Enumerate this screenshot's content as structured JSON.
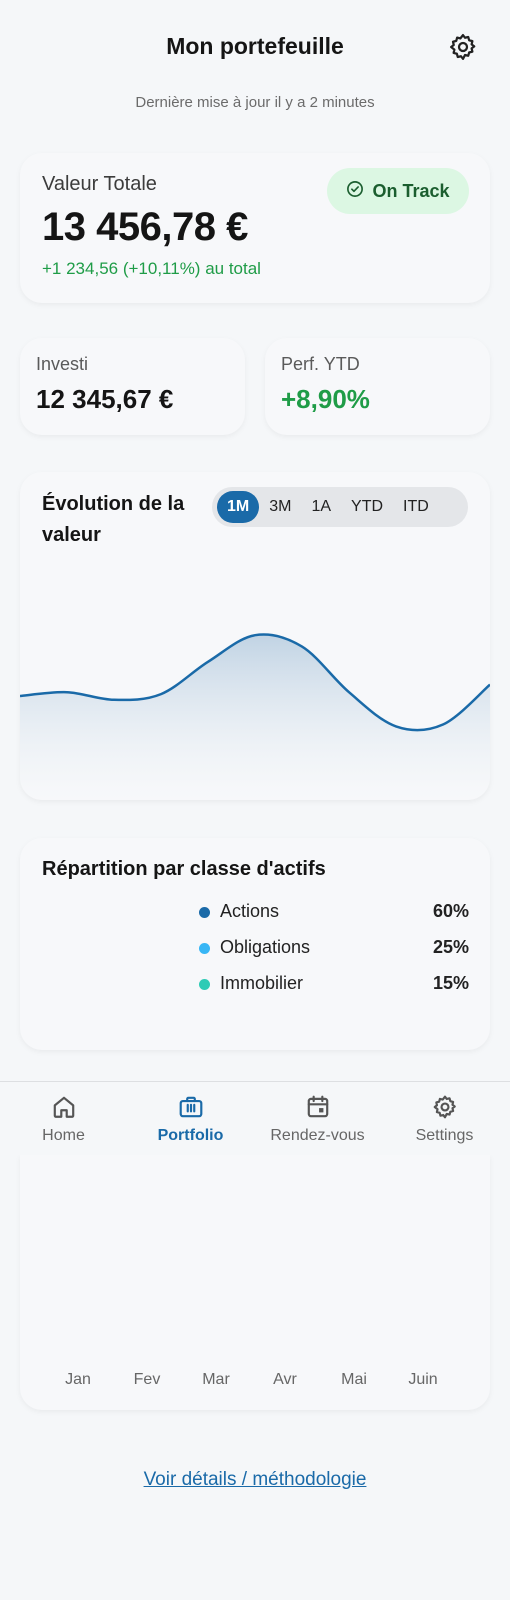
{
  "header": {
    "title": "Mon portefeuille",
    "updated": "Dernière mise à jour il y a 2 minutes",
    "settings_icon": "gear-icon"
  },
  "summary": {
    "label": "Valeur Totale",
    "value": "13 456,78 €",
    "change": "+1 234,56 (+10,11%) au total",
    "badge": "On Track",
    "badge_icon": "check-circle-icon"
  },
  "stats": {
    "invested_label": "Investi",
    "invested_value": "12 345,67 €",
    "ytd_label": "Perf. YTD",
    "ytd_value": "+8,90%"
  },
  "chart": {
    "title": "Évolution de la valeur",
    "ranges": [
      "1M",
      "3M",
      "1A",
      "YTD",
      "ITD"
    ],
    "active_range": "1M",
    "line_color": "#1a6aa8"
  },
  "allocation": {
    "title": "Répartition par classe d'actifs",
    "items": [
      {
        "name": "Actions",
        "pct": "60%",
        "color": "#1a6aa8"
      },
      {
        "name": "Obligations",
        "pct": "25%",
        "color": "#38b6f5"
      },
      {
        "name": "Immobilier",
        "pct": "15%",
        "color": "#2ecbb5"
      }
    ]
  },
  "tabbar": {
    "items": [
      {
        "label": "Home",
        "icon": "home-icon"
      },
      {
        "label": "Portfolio",
        "icon": "briefcase-icon"
      },
      {
        "label": "Rendez-vous",
        "icon": "calendar-icon"
      },
      {
        "label": "Settings",
        "icon": "gear-icon"
      }
    ],
    "active": "Portfolio"
  },
  "monthly": {
    "months": [
      "Jan",
      "Fev",
      "Mar",
      "Avr",
      "Mai",
      "Juin"
    ]
  },
  "footer": {
    "link": "Voir détails / méthodologie"
  },
  "chart_data": {
    "type": "area",
    "title": "Évolution de la valeur",
    "x": [
      0,
      1,
      2,
      3,
      4,
      5,
      6,
      7,
      8,
      9,
      10
    ],
    "values": [
      0.4,
      0.42,
      0.38,
      0.41,
      0.58,
      0.72,
      0.66,
      0.42,
      0.24,
      0.25,
      0.46
    ],
    "ylim": [
      0,
      1
    ],
    "grid": false,
    "legend": "none"
  }
}
